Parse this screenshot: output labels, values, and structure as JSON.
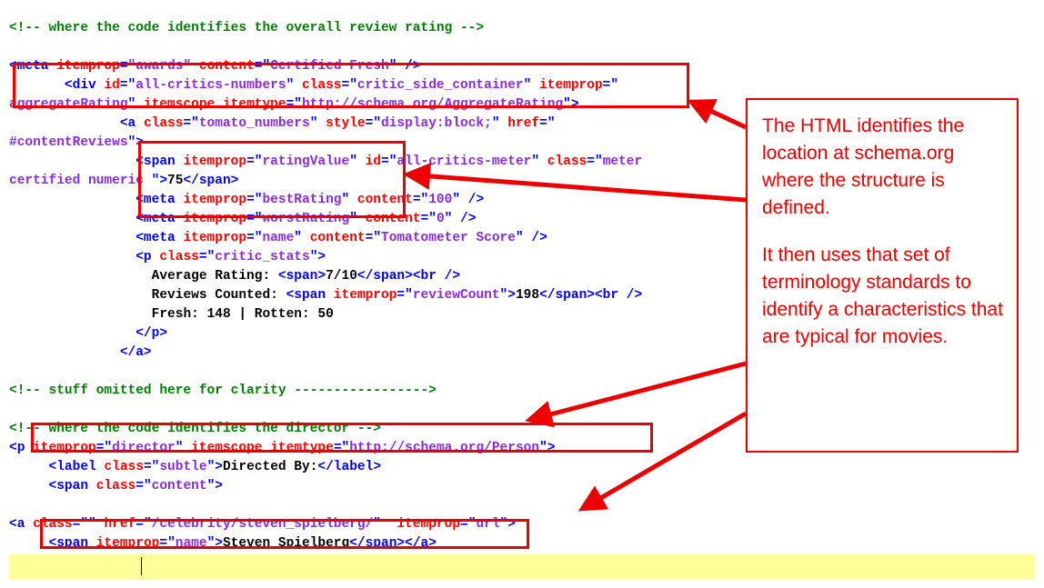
{
  "code": {
    "comment_review": "<!-- where the code identifies the overall review rating -->",
    "awards_content": "Certified Fresh",
    "div_id": "all-critics-numbers",
    "div_class": "critic_side_container",
    "div_itemprop": "aggregateRating",
    "div_itemtype": "http://schema.org/AggregateRating",
    "a_class": "tomato_numbers",
    "a_style": "display:block;",
    "a_href": "#contentReviews",
    "span_itemprop_ratingValue": "ratingValue",
    "span_id_meter": "all-critics-meter",
    "span_class_meter": "meter certified numeric ",
    "rating_value": "75",
    "bestRating": "100",
    "worstRating": "0",
    "meta_name_content": "Tomatometer Score",
    "p_class_stats": "critic_stats",
    "avg_rating_label": "Average Rating: ",
    "avg_rating_value": "7/10",
    "reviews_counted_label": "Reviews Counted: ",
    "review_count_itemprop": "reviewCount",
    "review_count_value": "198",
    "fresh_rotten": "Fresh: 148 | Rotten: 50",
    "comment_omitted": "<!-- stuff omitted here for clarity ----------------->",
    "comment_director": "<!-- where the code identifies the director -->",
    "p_itemprop_director": "director",
    "p_itemtype_person": "http://schema.org/Person",
    "label_class": "subtle",
    "label_text": "Directed By:",
    "span_class_content": "content",
    "a2_href": "/celebrity/steven_spielberg/",
    "a2_itemprop": "url",
    "span_itemprop_name": "name",
    "director_name": "Steven Spielberg"
  },
  "callout": {
    "p1": "The HTML identifies the location at schema.org where the structure is defined.",
    "p2": "It then uses that set of terminology standards to identify a characteristics that are typical for movies."
  }
}
